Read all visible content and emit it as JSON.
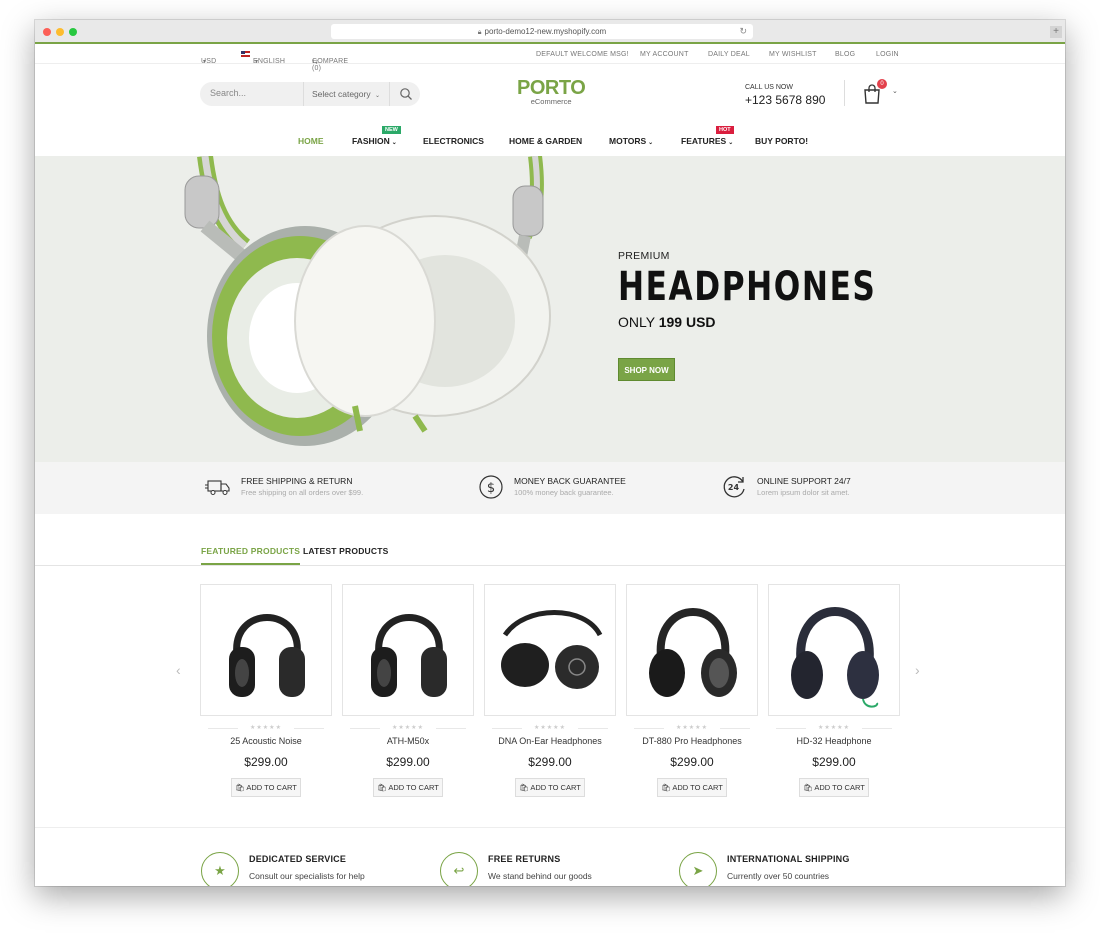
{
  "browser": {
    "url": "porto-demo12-new.myshopify.com"
  },
  "topbar": {
    "currency": "USD",
    "language": "ENGLISH",
    "compare": "COMPARE (0)",
    "welcome": "DEFAULT WELCOME MSG!",
    "links": [
      "MY ACCOUNT",
      "DAILY DEAL",
      "MY WISHLIST",
      "BLOG",
      "LOGIN"
    ]
  },
  "header": {
    "search_placeholder": "Search...",
    "category_label": "Select category",
    "logo_main": "PORTO",
    "logo_sub": "eCommerce",
    "call_label": "CALL US NOW",
    "phone": "+123 5678 890",
    "cart_count": "0"
  },
  "nav": {
    "items": [
      "HOME",
      "FASHION",
      "ELECTRONICS",
      "HOME & GARDEN",
      "MOTORS",
      "FEATURES",
      "BUY PORTO!"
    ],
    "tag_new": "NEW",
    "tag_hot": "HOT"
  },
  "hero": {
    "eyebrow": "PREMIUM",
    "title": "HEADPHONES",
    "price_prefix": "ONLY",
    "price": "199 USD",
    "cta": "SHOP NOW"
  },
  "features": [
    {
      "title": "FREE SHIPPING & RETURN",
      "subtitle": "Free shipping on all orders over $99.",
      "icon": "truck-icon"
    },
    {
      "title": "MONEY BACK GUARANTEE",
      "subtitle": "100% money back guarantee.",
      "icon": "dollar-icon"
    },
    {
      "title": "ONLINE SUPPORT 24/7",
      "subtitle": "Lorem ipsum dolor sit amet.",
      "icon": "support-24-icon"
    }
  ],
  "tabs": {
    "featured": "FEATURED PRODUCTS",
    "latest": "LATEST PRODUCTS"
  },
  "products": [
    {
      "name": "25 Acoustic Noise",
      "price": "$299.00",
      "button": "ADD TO CART"
    },
    {
      "name": "ATH-M50x",
      "price": "$299.00",
      "button": "ADD TO CART"
    },
    {
      "name": "DNA On-Ear Headphones",
      "price": "$299.00",
      "button": "ADD TO CART"
    },
    {
      "name": "DT-880 Pro Headphones",
      "price": "$299.00",
      "button": "ADD TO CART"
    },
    {
      "name": "HD-32 Headphone",
      "price": "$299.00",
      "button": "ADD TO CART"
    }
  ],
  "services": [
    {
      "title": "DEDICATED SERVICE",
      "subtitle": "Consult our specialists for help",
      "icon": "star-icon"
    },
    {
      "title": "FREE RETURNS",
      "subtitle": "We stand behind our goods",
      "icon": "return-arrow-icon"
    },
    {
      "title": "INTERNATIONAL SHIPPING",
      "subtitle": "Currently over 50 countries",
      "icon": "paper-plane-icon"
    }
  ],
  "colors": {
    "accent": "#7aa446",
    "hot": "#da1e3e",
    "new": "#2ba968",
    "hero_bg": "#eceeea"
  }
}
